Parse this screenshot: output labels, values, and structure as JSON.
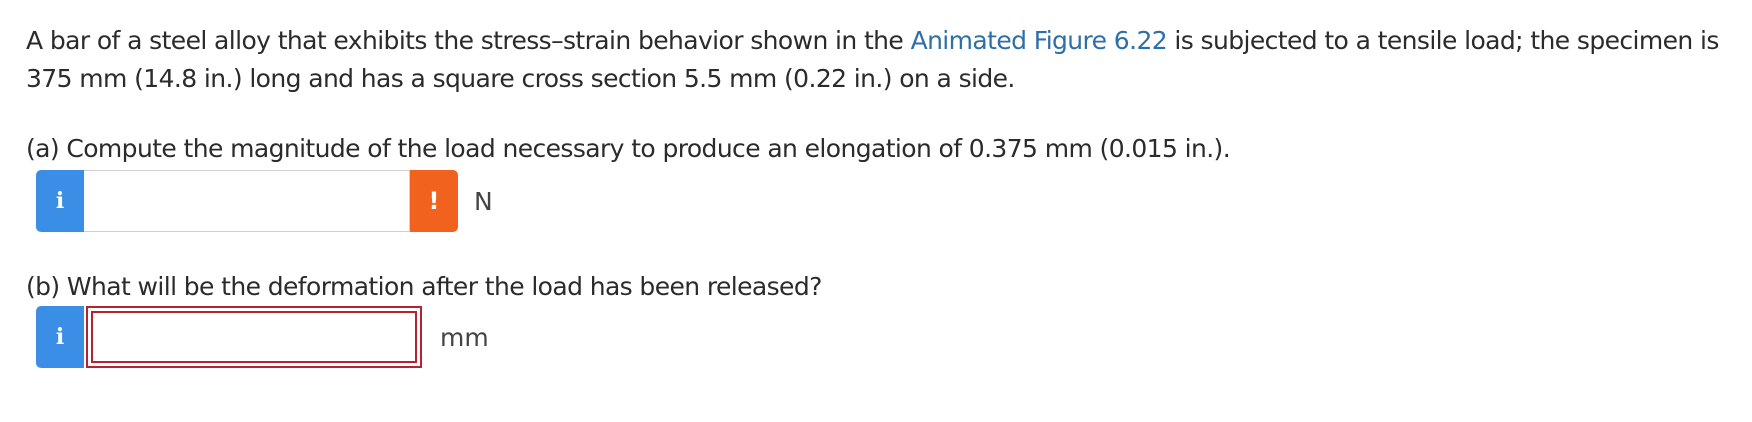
{
  "problem": {
    "text_before_link": "A bar of a steel alloy that exhibits the stress–strain behavior shown in the ",
    "link_text": "Animated Figure 6.22",
    "text_after_link": " is subjected to a tensile load; the specimen is 375 mm (14.8 in.) long and has a square cross section 5.5 mm (0.22 in.) on a side."
  },
  "part_a": {
    "question": "(a) Compute the magnitude of the load necessary to produce an elongation of 0.375 mm (0.015 in.).",
    "info_glyph": "i",
    "input_value": "",
    "warning_glyph": "!",
    "unit": "N"
  },
  "part_b": {
    "question": "(b) What will be the deformation after the load has been released?",
    "info_glyph": "i",
    "input_value": "",
    "unit": "mm"
  },
  "colors": {
    "link": "#2f6fa8",
    "info_button": "#3a8ee6",
    "warning_button": "#f0621d",
    "error_border": "#b52330"
  },
  "icons": {
    "info": "info-icon",
    "warning": "exclamation-icon"
  }
}
